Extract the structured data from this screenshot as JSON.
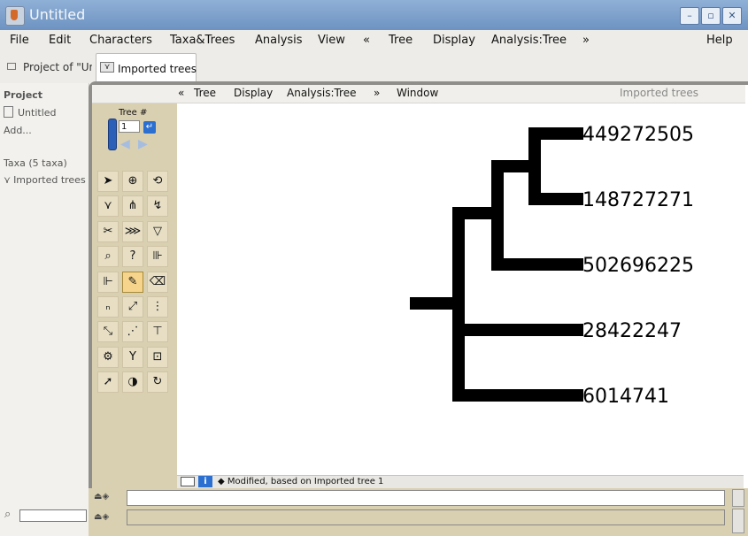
{
  "window": {
    "title": "Untitled",
    "buttons": [
      "–",
      "▫",
      "✕"
    ]
  },
  "menubar": [
    "File",
    "Edit",
    "Characters",
    "Taxa&Trees",
    "Analysis",
    "View",
    "«",
    "Tree",
    "Display",
    "Analysis:Tree",
    "»",
    "Help"
  ],
  "tabs": {
    "project": "Project of \"Untitled\"",
    "imported": "Imported trees"
  },
  "project_panel": {
    "heading": "Project",
    "file": "Untitled",
    "add": "Add...",
    "taxa": "Taxa (5 taxa)",
    "trees": "Imported trees"
  },
  "inner_menu": {
    "items": [
      "«",
      "Tree",
      "Display",
      "Analysis:Tree",
      "»",
      "Window"
    ],
    "right_title": "Imported trees"
  },
  "palette": {
    "tree_label": "Tree #",
    "tree_number": "1",
    "enter_glyph": "↵",
    "prev_glyph": "◀",
    "next_glyph": "▶",
    "tools": [
      "arrow-tool-icon",
      "magnify-tool-icon",
      "rotate-tool-icon",
      "ladderize-tool-icon",
      "polytomy-tool-icon",
      "reroot-tool-icon",
      "scissors-tool-icon",
      "branch-tool-icon",
      "collapse-tool-icon",
      "search-tool-icon",
      "help-tool-icon",
      "ruler-tool-icon",
      "measure-tool-icon",
      "paint-brush-tool-icon",
      "tag-tool-icon",
      "name-tool-icon",
      "arrange-tool-icon",
      "expand-tool-icon",
      "prune-tool-icon",
      "connect-tool-icon",
      "ruler2-tool-icon",
      "gear-tool-icon",
      "fork-tool-icon",
      "lock-tool-icon",
      "pointer-tool-icon",
      "color-tool-icon",
      "cycle-tool-icon"
    ],
    "tool_glyphs": [
      "➤",
      "⊕",
      "⟲",
      "⋎",
      "⋔",
      "↯",
      "✂",
      "⋙",
      "▽",
      "⌕",
      "?",
      "⊪",
      "⊩",
      "✎",
      "⌫",
      "ₙ",
      "⤢",
      "⋮",
      "⤡",
      "⋰",
      "⊤",
      "⚙",
      "Y",
      "⊡",
      "➚",
      "◑",
      "↻"
    ],
    "selected_index": 13
  },
  "tree": {
    "taxa": [
      "449272505",
      "148727271",
      "502696225",
      "28422247",
      "6014741"
    ],
    "branch_color": "#000000"
  },
  "status": {
    "text": "◆ Modified, based on Imported tree 1"
  },
  "colors": {
    "titlebar": "#7c9ccb",
    "palette": "#d9cfb1",
    "selected_tool": "#f6d48c"
  }
}
